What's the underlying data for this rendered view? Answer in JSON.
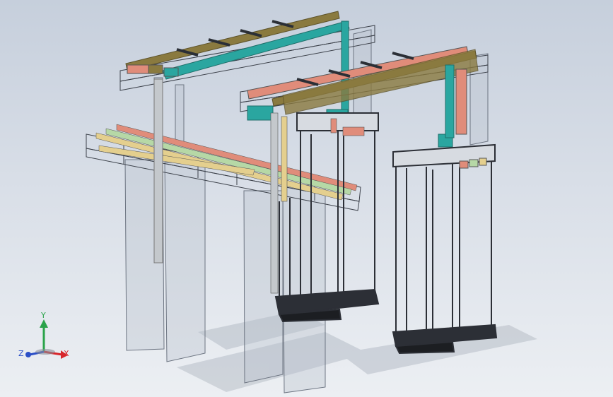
{
  "model": {
    "view": "isometric",
    "objects": [
      "cable-tray-upper-left",
      "cable-tray-upper-right",
      "cable-tray-lower",
      "busbar-set",
      "cabinet-pair-center",
      "cabinet-pair-right",
      "glass-panels"
    ]
  },
  "triad": {
    "y_label": "Y",
    "x_label": "X",
    "z_label": "Z",
    "colors": {
      "x": "#d8262b",
      "y": "#2aa34a",
      "z": "#2b4fc7"
    }
  },
  "colors": {
    "teal": "#2aa6a0",
    "olive": "#8a7a3f",
    "salmon": "#e08c7a",
    "sand": "#e4cf8e",
    "mint": "#b6d8a6",
    "frame": "#2c2f36"
  }
}
